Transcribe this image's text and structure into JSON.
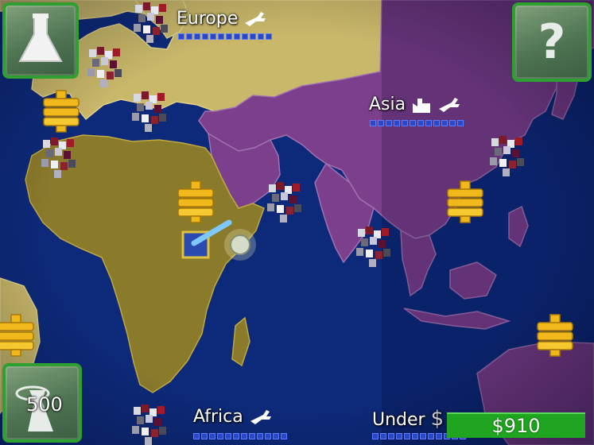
{
  "hud": {
    "lab_button_icon": "flask-icon",
    "help_button_icon": "question-mark-icon",
    "help_glyph": "?",
    "army_button_icon": "soldier-icon",
    "army_count": "500",
    "money": "$910"
  },
  "regions": [
    {
      "key": "europe",
      "name": "Europe",
      "icons": [
        "rifle-icon"
      ],
      "bar_segments": 12
    },
    {
      "key": "asia",
      "name": "Asia",
      "icons": [
        "factory-icon",
        "rifle-icon"
      ],
      "bar_segments": 12
    },
    {
      "key": "africa",
      "name": "Africa",
      "icons": [
        "rifle-icon"
      ],
      "bar_segments": 12
    },
    {
      "key": "under",
      "name": "Under",
      "icons": [
        "dollar-icon"
      ],
      "bar_segments": 12
    }
  ],
  "colors": {
    "ocean": "#0d2a7a",
    "europe_land": "#c9b86a",
    "asia_land": "#7b3f8c",
    "africa_land": "#8a7a2c",
    "button_border": "#2fa02f",
    "money_bg": "#1fa51f",
    "bar": "#2848c8",
    "coin": "#f0b81a"
  }
}
